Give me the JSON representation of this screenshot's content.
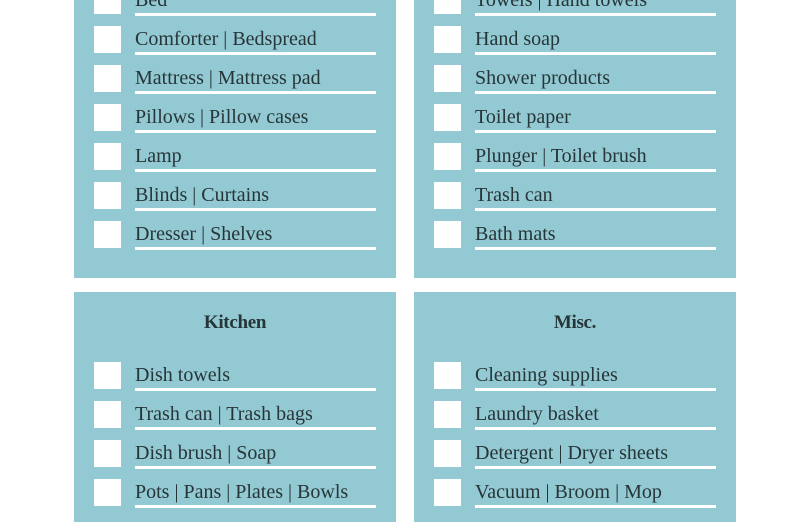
{
  "panels": [
    {
      "title": "",
      "items": [
        "Bed",
        "Comforter | Bedspread",
        "Mattress | Mattress pad",
        "Pillows | Pillow cases",
        "Lamp",
        "Blinds | Curtains",
        "Dresser | Shelves"
      ]
    },
    {
      "title": "",
      "items": [
        "Towels | Hand towels",
        "Hand soap",
        "Shower products",
        "Toilet paper",
        "Plunger | Toilet brush",
        "Trash can",
        "Bath mats"
      ]
    },
    {
      "title": "Kitchen",
      "items": [
        "Dish towels",
        "Trash can | Trash bags",
        "Dish brush | Soap",
        "Pots | Pans | Plates | Bowls"
      ]
    },
    {
      "title": "Misc.",
      "items": [
        "Cleaning supplies",
        "Laundry basket",
        "Detergent | Dryer sheets",
        "Vacuum | Broom | Mop"
      ]
    }
  ],
  "colors": {
    "panel": "#93c9d3",
    "text": "#263537",
    "checkbox": "#ffffff"
  }
}
